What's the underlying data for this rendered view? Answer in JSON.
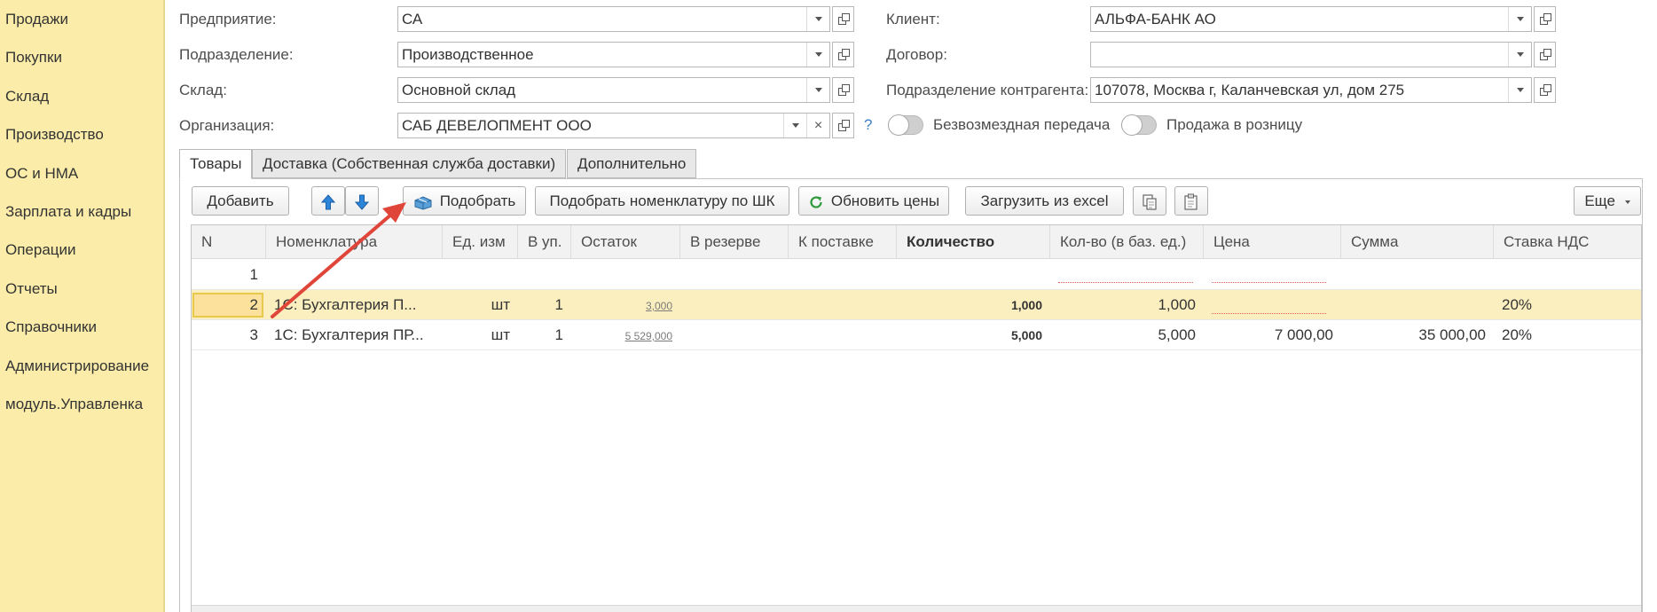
{
  "sidebar": {
    "items": [
      {
        "label": "Продажи"
      },
      {
        "label": "Покупки"
      },
      {
        "label": "Склад"
      },
      {
        "label": "Производство"
      },
      {
        "label": "ОС и НМА"
      },
      {
        "label": "Зарплата и кадры"
      },
      {
        "label": "Операции"
      },
      {
        "label": "Отчеты"
      },
      {
        "label": "Справочники"
      },
      {
        "label": "Администрирование"
      },
      {
        "label": "модуль.Управленка"
      }
    ]
  },
  "form": {
    "enterprise": {
      "label": "Предприятие:",
      "value": "СА"
    },
    "department": {
      "label": "Подразделение:",
      "value": "Производственное"
    },
    "warehouse": {
      "label": "Склад:",
      "value": "Основной склад"
    },
    "organization": {
      "label": "Организация:",
      "value": "САБ ДЕВЕЛОПМЕНТ ООО"
    },
    "help_mark": "?",
    "client": {
      "label": "Клиент:",
      "value": "АЛЬФА-БАНК АО"
    },
    "contract": {
      "label": "Договор:",
      "value": ""
    },
    "counterparty_department": {
      "label": "Подразделение контрагента:",
      "value": "107078, Москва г, Каланчевская ул, дом 275"
    },
    "free_transfer": {
      "label": "Безвозмездная передача",
      "on": false
    },
    "retail_sale": {
      "label": "Продажа в розницу",
      "on": false
    }
  },
  "tabs": [
    {
      "label": "Товары",
      "active": true
    },
    {
      "label": "Доставка (Собственная служба доставки)",
      "active": false
    },
    {
      "label": "Дополнительно",
      "active": false
    }
  ],
  "toolbar": {
    "add": "Добавить",
    "pick": "Подобрать",
    "pick_by_barcode": "Подобрать номенклатуру по ШК",
    "update_prices": "Обновить цены",
    "load_excel": "Загрузить из excel",
    "more": "Еще"
  },
  "table": {
    "columns": [
      "N",
      "Номенклатура",
      "Ед. изм",
      "В уп.",
      "Остаток",
      "В резерве",
      "К поставке",
      "Количество",
      "Кол-во (в баз. ед.)",
      "Цена",
      "Сумма",
      "Ставка НДС"
    ],
    "rows": [
      {
        "n": "1",
        "item": "",
        "unit": "",
        "pack": "",
        "stock": "",
        "reserve": "",
        "to_deliver": "",
        "qty": "",
        "qty_base": "",
        "price": "",
        "sum": "",
        "vat": ""
      },
      {
        "n": "2",
        "item": "1С:  Бухгалтерия П...",
        "unit": "шт",
        "pack": "1",
        "stock": "3,000",
        "reserve": "",
        "to_deliver": "",
        "qty": "1,000",
        "qty_base": "1,000",
        "price": "",
        "sum": "",
        "vat": "20%"
      },
      {
        "n": "3",
        "item": "1С: Бухгалтерия ПР...",
        "unit": "шт",
        "pack": "1",
        "stock": "5 529,000",
        "reserve": "",
        "to_deliver": "",
        "qty": "5,000",
        "qty_base": "5,000",
        "price": "7 000,00",
        "sum": "35 000,00",
        "vat": "20%"
      }
    ]
  },
  "colors": {
    "sidebar_bg": "#fbeda9",
    "selected_row": "#fcefbf",
    "annotation_arrow": "#e0453a",
    "link_blue": "#3a7dc2"
  }
}
